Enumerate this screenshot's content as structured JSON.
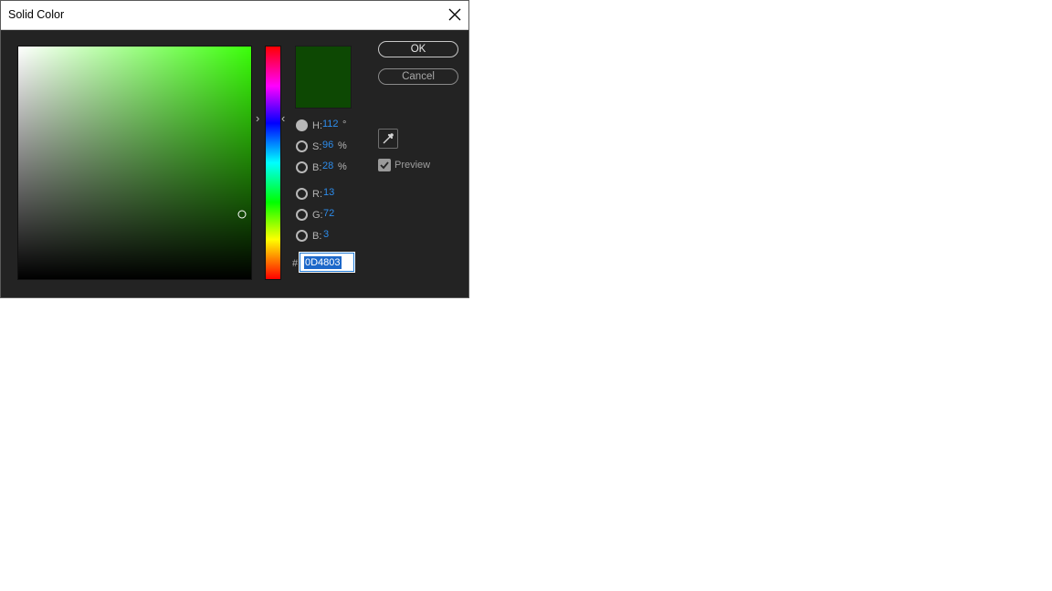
{
  "window": {
    "title": "Solid Color"
  },
  "color": {
    "hex_css": "#0D4803",
    "hue_css": "#3bff0a",
    "saturation_fraction": 0.96,
    "brightness_fraction": 0.28,
    "hue_fraction_from_top": 0.311
  },
  "fields": {
    "h": {
      "label": "H:",
      "value": "112",
      "unit": "°",
      "selected": true
    },
    "s": {
      "label": "S:",
      "value": "96",
      "unit": "%"
    },
    "b": {
      "label": "B:",
      "value": "28",
      "unit": "%"
    },
    "r": {
      "label": "R:",
      "value": "13"
    },
    "g": {
      "label": "G:",
      "value": "72"
    },
    "b2": {
      "label": "B:",
      "value": "3"
    }
  },
  "hex": {
    "prefix": "#",
    "value": "0D4803"
  },
  "buttons": {
    "ok": "OK",
    "cancel": "Cancel"
  },
  "preview": {
    "label": "Preview",
    "checked": true
  },
  "icons": {
    "close": "close-icon",
    "eyedropper": "eyedropper-icon",
    "check": "checkmark-icon"
  }
}
